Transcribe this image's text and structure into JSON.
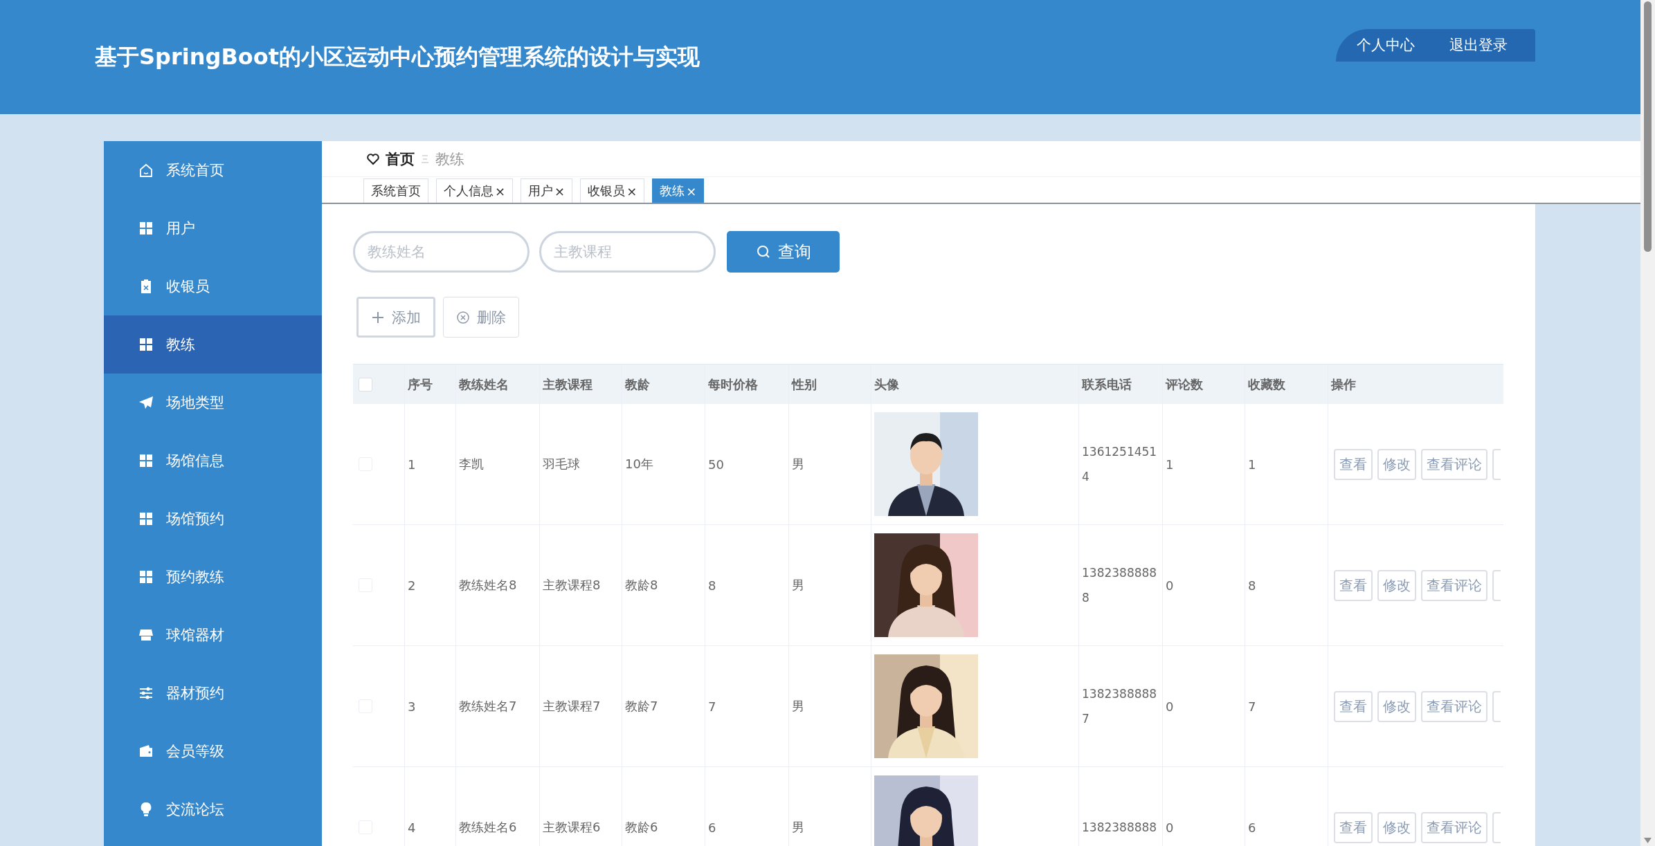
{
  "header": {
    "title": "基于SpringBoot的小区运动中心预约管理系统的设计与实现",
    "links": [
      {
        "label": "个人中心"
      },
      {
        "label": "退出登录"
      }
    ]
  },
  "sidebar": {
    "items": [
      {
        "label": "系统首页",
        "selected": false
      },
      {
        "label": "用户",
        "selected": false
      },
      {
        "label": "收银员",
        "selected": false
      },
      {
        "label": "教练",
        "selected": true
      },
      {
        "label": "场地类型",
        "selected": false
      },
      {
        "label": "场馆信息",
        "selected": false
      },
      {
        "label": "场馆预约",
        "selected": false
      },
      {
        "label": "预约教练",
        "selected": false
      },
      {
        "label": "球馆器材",
        "selected": false
      },
      {
        "label": "器材预约",
        "selected": false
      },
      {
        "label": "会员等级",
        "selected": false
      },
      {
        "label": "交流论坛",
        "selected": false
      }
    ]
  },
  "breadcrumb": {
    "home": "首页",
    "current": "教练"
  },
  "tabs": [
    {
      "label": "系统首页",
      "selected": false
    },
    {
      "label": "个人信息",
      "close": "×",
      "selected": false
    },
    {
      "label": "用户",
      "close": "×",
      "selected": false
    },
    {
      "label": "收银员",
      "close": "×",
      "selected": false
    },
    {
      "label": "教练",
      "close": "×",
      "selected": true
    }
  ],
  "search": {
    "fields": [
      {
        "placeholder": "教练姓名"
      },
      {
        "placeholder": "主教课程"
      }
    ],
    "button": "查询"
  },
  "toolbar": {
    "buttons": [
      {
        "label": "添加",
        "kind": "add"
      },
      {
        "label": "删除",
        "kind": "delete"
      }
    ]
  },
  "table": {
    "select_all_checked": false,
    "columns": [
      "序号",
      "教练姓名",
      "主教课程",
      "教龄",
      "每时价格",
      "性别",
      "头像",
      "联系电话",
      "评论数",
      "收藏数",
      "操作"
    ],
    "rows": [
      {
        "checked": false,
        "index": "1",
        "name": "李凯",
        "course": "羽毛球",
        "years": "10年",
        "price": "50",
        "gender": "男",
        "photo": {
          "kind": "picture"
        },
        "phone": "13612514514",
        "comments": "1",
        "favorites": "1",
        "actions": [
          "查看",
          "修改",
          "查看评论"
        ]
      },
      {
        "checked": false,
        "index": "2",
        "name": "教练姓名8",
        "course": "主教课程8",
        "years": "教龄8",
        "price": "8",
        "gender": "男",
        "photo": {
          "kind": "picture"
        },
        "phone": "13823888888",
        "comments": "0",
        "favorites": "8",
        "actions": [
          "查看",
          "修改",
          "查看评论"
        ]
      },
      {
        "checked": false,
        "index": "3",
        "name": "教练姓名7",
        "course": "主教课程7",
        "years": "教龄7",
        "price": "7",
        "gender": "男",
        "photo": {
          "kind": "picture"
        },
        "phone": "13823888887",
        "comments": "0",
        "favorites": "7",
        "actions": [
          "查看",
          "修改",
          "查看评论"
        ]
      },
      {
        "checked": false,
        "index": "4",
        "name": "教练姓名6",
        "course": "主教课程6",
        "years": "教龄6",
        "price": "6",
        "gender": "男",
        "photo": {
          "kind": "picture"
        },
        "phone": "1382388888",
        "comments": "0",
        "favorites": "6",
        "actions": [
          "查看",
          "修改",
          "查看评论"
        ]
      }
    ]
  }
}
